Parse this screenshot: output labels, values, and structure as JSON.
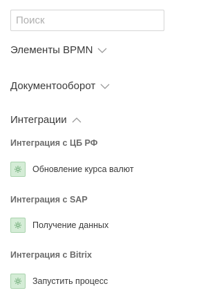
{
  "search": {
    "placeholder": "Поиск",
    "value": ""
  },
  "groups": [
    {
      "label": "Элементы BPMN",
      "state": "collapsed",
      "chevron": "chevron-down-icon"
    },
    {
      "label": "Документооборот",
      "state": "collapsed",
      "chevron": "chevron-down-icon"
    },
    {
      "label": "Интеграции",
      "state": "expanded",
      "chevron": "chevron-up-icon"
    }
  ],
  "integrations": [
    {
      "title": "Интеграция с ЦБ РФ",
      "item": "Обновление курса валют",
      "icon": "gear-icon"
    },
    {
      "title": "Интеграция с SAP",
      "item": "Получение данных",
      "icon": "gear-icon"
    },
    {
      "title": "Интеграция с Bitrix",
      "item": "Запустить процесс",
      "icon": "gear-icon"
    }
  ],
  "colors": {
    "icon_bg": "#d4ecd6",
    "icon_border": "#a9d3ad",
    "icon_fg": "#6aa873",
    "chevron": "#9a9a9a"
  }
}
